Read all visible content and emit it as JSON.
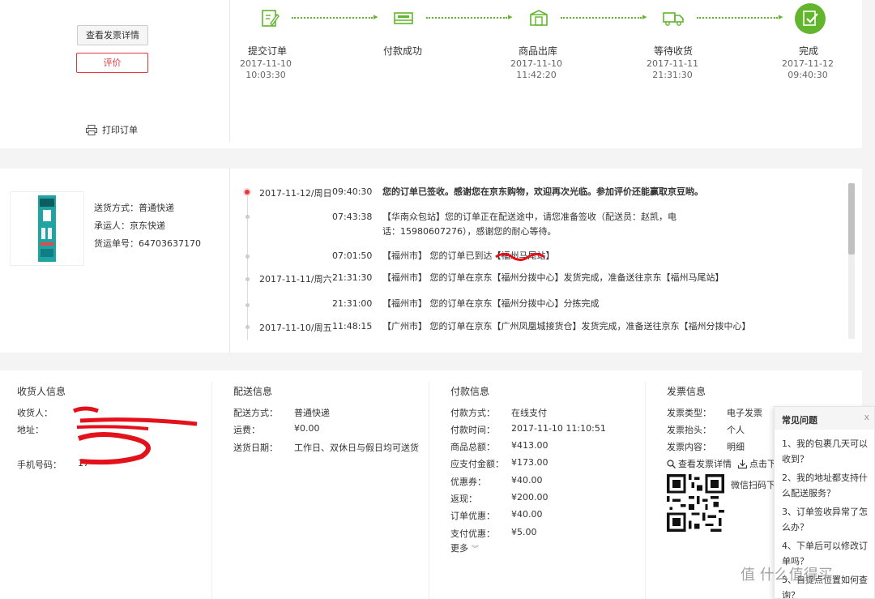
{
  "top": {
    "view_invoice_label": "查看发票详情",
    "review_label": "评价",
    "print_label": "打印订单",
    "steps": [
      {
        "label": "提交订单",
        "date": "2017-11-10",
        "time": "10:03:30"
      },
      {
        "label": "付款成功",
        "date": "",
        "time": ""
      },
      {
        "label": "商品出库",
        "date": "2017-11-10",
        "time": "11:42:20"
      },
      {
        "label": "等待收货",
        "date": "2017-11-11",
        "time": "21:31:30"
      },
      {
        "label": "完成",
        "date": "2017-11-12",
        "time": "09:40:30"
      }
    ]
  },
  "shipping": {
    "method": "送货方式：普通快递",
    "carrier": "承运人：京东快递",
    "tracking_no": "货运单号：64703637170"
  },
  "timeline": [
    {
      "date": "2017-11-12/周日",
      "time": "09:40:30",
      "msg": "您的订单已签收。感谢您在京东购物，欢迎再次光临。参加评价还能赢取京豆哟。",
      "bold": true
    },
    {
      "date": "",
      "time": "07:43:38",
      "msg": "【华南众包站】您的订单正在配送途中，请您准备签收（配送员：赵凯，电话：15980607276），感谢您的耐心等待。",
      "bold": false
    },
    {
      "date": "",
      "time": "07:01:50",
      "msg": "【福州市】 您的订单已到达【福州马尾站】",
      "bold": false
    },
    {
      "date": "2017-11-11/周六",
      "time": "21:31:30",
      "msg": "【福州市】 您的订单在京东【福州分拨中心】发货完成，准备送往京东【福州马尾站】",
      "bold": false
    },
    {
      "date": "",
      "time": "21:31:00",
      "msg": "【福州市】 您的订单在京东【福州分拨中心】分拣完成",
      "bold": false
    },
    {
      "date": "2017-11-10/周五",
      "time": "11:48:15",
      "msg": "【广州市】 您的订单在京东【广州凤凰城接货仓】发货完成，准备送往京东【福州分拨中心】",
      "bold": false
    }
  ],
  "info": {
    "receiver": {
      "title": "收货人信息",
      "name_key": "收货人：",
      "address_key": "地址：",
      "phone_key": "手机号码：",
      "phone_partial": "17"
    },
    "delivery": {
      "title": "配送信息",
      "rows": [
        {
          "k": "配送方式：",
          "v": "普通快递"
        },
        {
          "k": "运费：",
          "v": "¥0.00"
        },
        {
          "k": "送货日期：",
          "v": "工作日、双休日与假日均可送货"
        }
      ]
    },
    "payment": {
      "title": "付款信息",
      "rows": [
        {
          "k": "付款方式：",
          "v": "在线支付"
        },
        {
          "k": "付款时间：",
          "v": "2017-11-10 11:10:51"
        },
        {
          "k": "商品总额：",
          "v": "¥413.00"
        },
        {
          "k": "应支付金额：",
          "v": "¥173.00"
        },
        {
          "k": "优惠券：",
          "v": "¥40.00"
        },
        {
          "k": "返现：",
          "v": "¥200.00"
        },
        {
          "k": "订单优惠：",
          "v": "¥40.00"
        },
        {
          "k": "支付优惠：",
          "v": "¥5.00"
        }
      ],
      "more_label": "更多"
    },
    "invoice": {
      "title": "发票信息",
      "rows": [
        {
          "k": "发票类型：",
          "v": "电子发票"
        },
        {
          "k": "发票抬头：",
          "v": "个人"
        },
        {
          "k": "发票内容：",
          "v": "明细"
        }
      ],
      "view_detail_label": "查看发票详情",
      "download_label": "点击下",
      "wechat_label": "微信扫码下"
    }
  },
  "faq": {
    "title": "常见问题",
    "items": [
      "1、我的包裹几天可以收到？",
      "2、我的地址都支持什么配送服务？",
      "3、订单签收异常了怎么办？",
      "4、下单后可以修改订单吗？",
      "5、自提点位置如何查询？"
    ]
  },
  "watermark": "值 什么值得买",
  "colors": {
    "accent_green": "#62b52c",
    "accent_red": "#e4393c"
  }
}
